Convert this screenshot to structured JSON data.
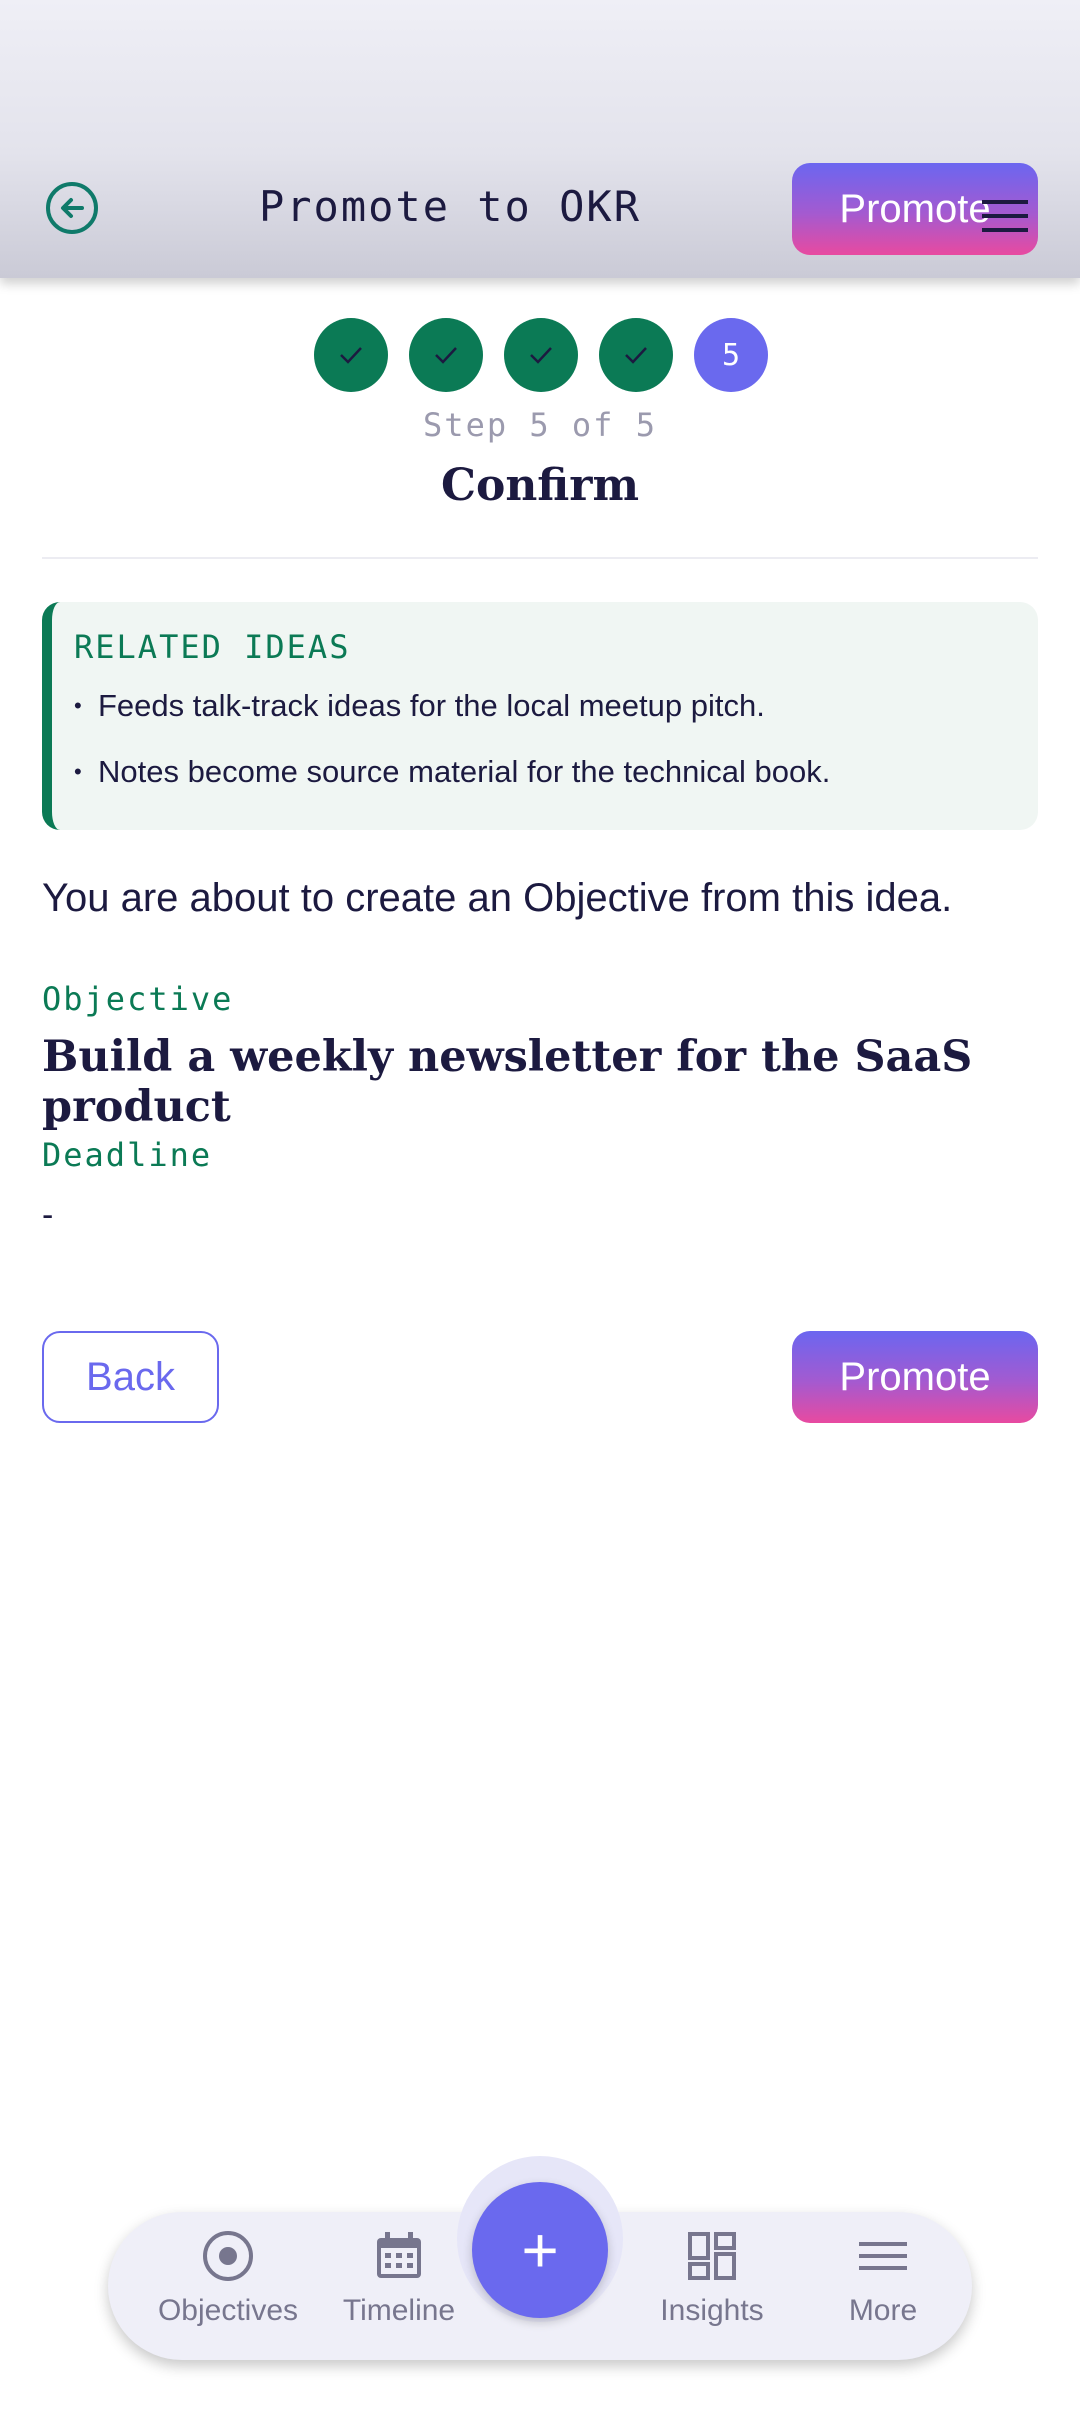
{
  "header": {
    "title": "Promote to OKR",
    "promote_label": "Promote"
  },
  "stepper": {
    "current_step_number": "5",
    "step_label": "Step 5 of 5",
    "title": "Confirm"
  },
  "related": {
    "title": "RELATED IDEAS",
    "items": [
      "Feeds talk-track ideas for the local meetup pitch.",
      "Notes become source material for the technical book."
    ]
  },
  "content": {
    "intro": "You are about to create an Objective from this idea.",
    "objective_label": "Objective",
    "objective_value": "Build a weekly newsletter for the SaaS product",
    "deadline_label": "Deadline",
    "deadline_value": "-"
  },
  "actions": {
    "back_label": "Back",
    "promote_label": "Promote"
  },
  "nav": {
    "items": [
      {
        "label": "Objectives",
        "icon": "target-icon"
      },
      {
        "label": "Timeline",
        "icon": "calendar-icon"
      },
      {
        "label": "Insights",
        "icon": "dashboard-icon"
      },
      {
        "label": "More",
        "icon": "menu-icon"
      }
    ],
    "fab_symbol": "+"
  },
  "colors": {
    "primary": "#6a69ee",
    "success": "#0b7a55",
    "gradient_start": "#6b66f0",
    "gradient_end": "#e84aa0",
    "text": "#1c1a40"
  }
}
